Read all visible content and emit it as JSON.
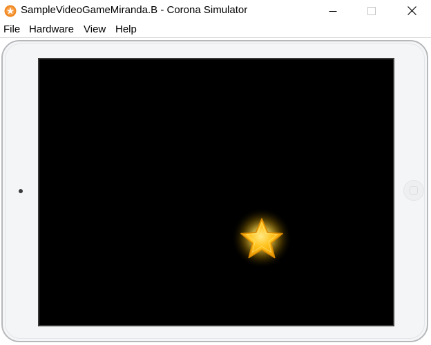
{
  "window": {
    "title": "SampleVideoGameMiranda.B - Corona Simulator",
    "app_icon": "corona-simulator-icon"
  },
  "menubar": {
    "items": [
      {
        "label": "File"
      },
      {
        "label": "Hardware"
      },
      {
        "label": "View"
      },
      {
        "label": "Help"
      }
    ]
  },
  "device": {
    "type": "tablet",
    "screen_color": "#000000",
    "frame_color": "#f4f5f6"
  },
  "game": {
    "sprite": "star-icon",
    "sprite_color": "#f4b400",
    "glow_color": "#fff27a"
  },
  "colors": {
    "accent": "#f08a24"
  }
}
